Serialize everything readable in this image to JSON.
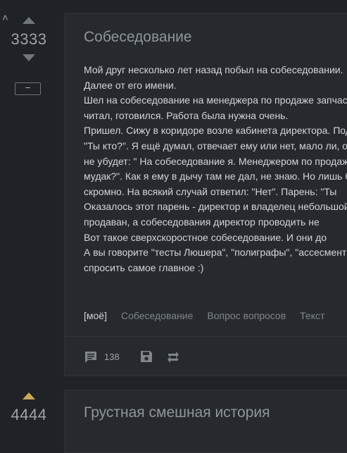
{
  "posts": [
    {
      "rating": "3333",
      "minus_label": "−",
      "title": "Собеседование",
      "body_lines": [
        "Мой друг несколько лет назад побыл на собеседовании.",
        "Далее от его имени.",
        "Шел на собеседование на менеджера по продаже запчастей,",
        "читал, готовился. Работа была нужна очень.",
        "Пришел. Сижу в коридоре возле кабинета директора. Подходит",
        "\"Ты кто?\". Я ещё думал, отвечает ему или нет, мало ли, от меня",
        "не убудет: \" На собеседование я. Менеджером по продажам. А",
        "мудак?\". Как я ему в дычу там не дал, не знаю. Но лишь бы",
        "скромно. На всякий случай ответил: \"Нет\". Парень: \"Ты",
        "Оказалось этот парень - директор и владелец небольшой",
        "продаван, а собеседования директор проводить не",
        "Вот такое сверхскоростное собеседование. И они до",
        "А вы говорите \"тесты Люшера\", \"полиграфы\", \"ассесмент",
        "спросить самое главное :)"
      ],
      "tags": [
        "[моё]",
        "Собеседование",
        "Вопрос вопросов",
        "Текст"
      ],
      "comments_count": "138"
    },
    {
      "rating": "4444",
      "title": "Грустная смешная история"
    }
  ],
  "colors": {
    "background": "#1f2226",
    "card": "#262a2f",
    "upvote_active": "#c9a85a"
  },
  "icons": [
    "collapse-caret-icon",
    "upvote-arrow-icon",
    "downvote-arrow-icon",
    "comment-icon",
    "save-icon",
    "repost-icon"
  ]
}
